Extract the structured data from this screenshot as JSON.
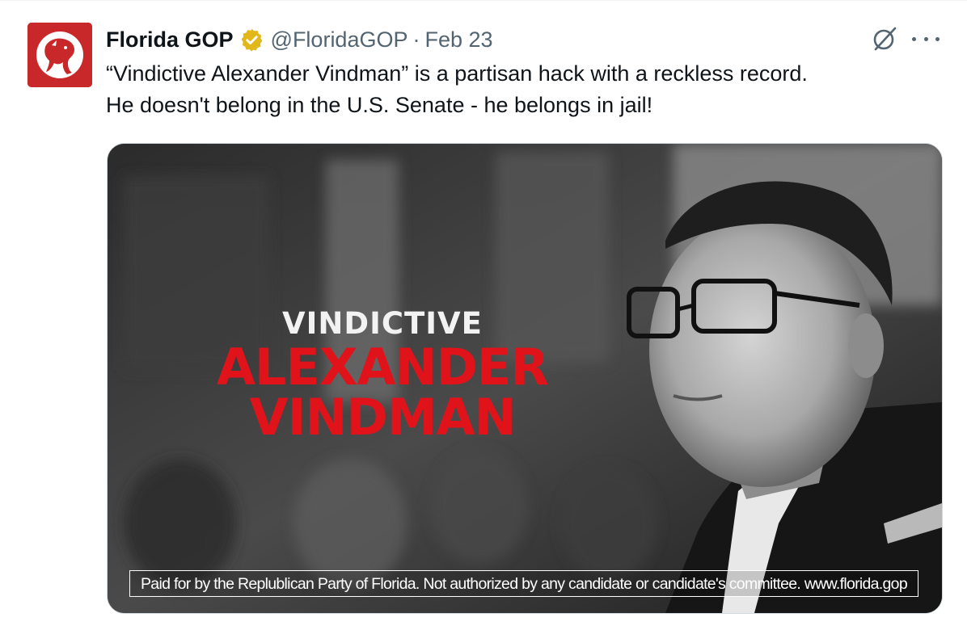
{
  "tweet": {
    "author": {
      "display_name": "Florida GOP",
      "handle": "@FloridaGOP",
      "verified_badge_color": "#e2b719",
      "avatar_color": "#c8282a",
      "avatar_icon": "elephant-logo"
    },
    "separator": "·",
    "date": "Feb 23",
    "text_lines": [
      "“Vindictive Alexander Vindman” is a partisan hack with a reckless record.",
      "He doesn't belong in the U.S. Senate - he belongs in jail!"
    ],
    "icons": {
      "grok": "grok-icon",
      "more": "more-icon"
    },
    "media": {
      "title_line1": "VINDICTIVE",
      "title_line2": "ALEXANDER",
      "title_line3": "VINDMAN",
      "title_accent_color": "#e0131b",
      "disclaimer": "Paid for by the Replublican Party of Florida. Not authorized by any candidate or candidate's committee. www.florida.gop"
    }
  }
}
